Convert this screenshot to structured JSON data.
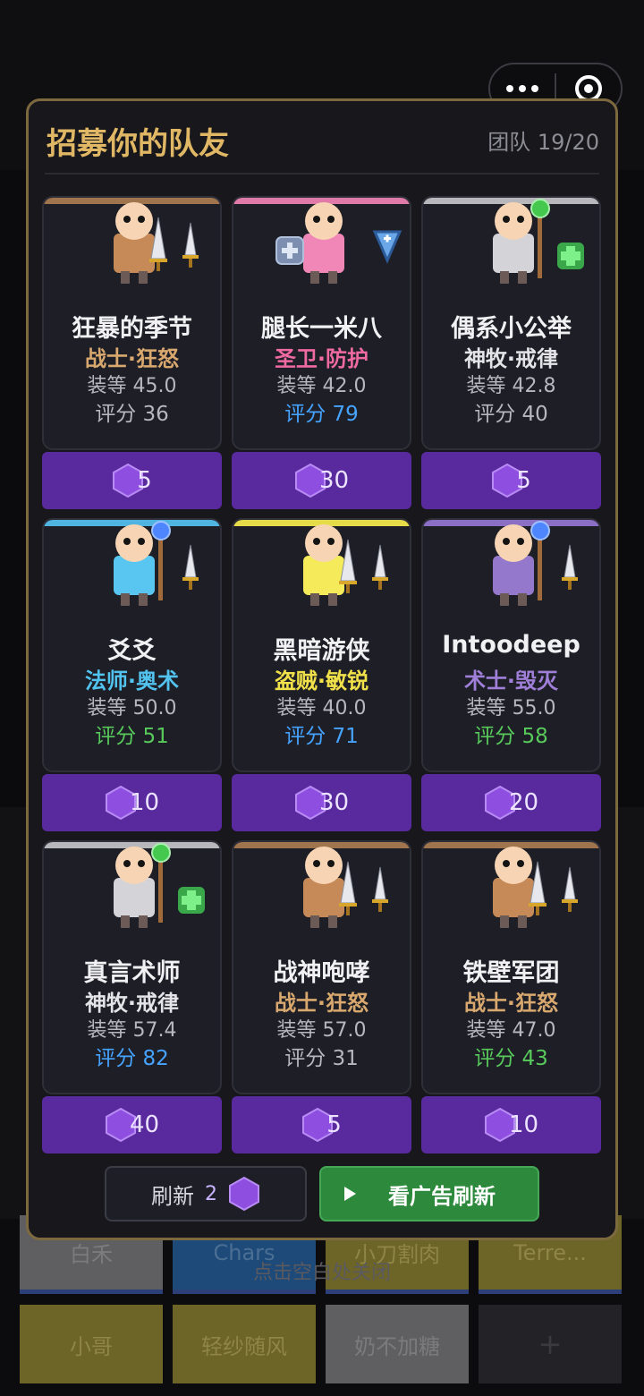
{
  "modal": {
    "title": "招募你的队友",
    "team_count": "团队 19/20"
  },
  "colors": {
    "gold": "#e0b765",
    "warrior": "#d8a86e",
    "paladin": "#ee6aa0",
    "priest": "#e4e4e8",
    "mage": "#52c3ef",
    "rogue": "#f0e04a",
    "warlock": "#a07fd8",
    "score_white": "#b7b7be",
    "score_blue": "#46a3ff",
    "score_green": "#58c95b",
    "price_purple": "#59299e"
  },
  "candidates": [
    {
      "name": "狂暴的季节",
      "class": "战士·狂怒",
      "gear": "装等 45.0",
      "score": "评分 36",
      "price": "5",
      "class_color": "#d8a86e",
      "score_color": "#b7b7be",
      "body": "#c58a58",
      "bar": "#a0754d",
      "icon": "sword-icon"
    },
    {
      "name": "腿长一米八",
      "class": "圣卫·防护",
      "gear": "装等 42.0",
      "score": "评分 79",
      "price": "30",
      "class_color": "#ee6aa0",
      "score_color": "#46a3ff",
      "body": "#f087b6",
      "bar": "#e07aa8",
      "icon": "shield-icon"
    },
    {
      "name": "偶系小公举",
      "class": "神牧·戒律",
      "gear": "装等 42.8",
      "score": "评分 40",
      "price": "5",
      "class_color": "#e4e4e8",
      "score_color": "#b7b7be",
      "body": "#d4d4d8",
      "bar": "#b8b8bc",
      "icon": "heal-cross-icon"
    },
    {
      "name": "爻爻",
      "class": "法师·奥术",
      "gear": "装等 50.0",
      "score": "评分 51",
      "price": "10",
      "class_color": "#52c3ef",
      "score_color": "#58c95b",
      "body": "#58c6f0",
      "bar": "#50b4e0",
      "icon": "sword-icon"
    },
    {
      "name": "黑暗游侠",
      "class": "盗贼·敏锐",
      "gear": "装等 40.0",
      "score": "评分 71",
      "price": "30",
      "class_color": "#f0e04a",
      "score_color": "#46a3ff",
      "body": "#f4ea5a",
      "bar": "#e6dc4a",
      "icon": "sword-icon"
    },
    {
      "name": "Intoodeep",
      "class": "术士·毁灭",
      "gear": "装等 55.0",
      "score": "评分 58",
      "price": "20",
      "class_color": "#a07fd8",
      "score_color": "#58c95b",
      "body": "#9478cc",
      "bar": "#8a6fc4",
      "icon": "sword-icon"
    },
    {
      "name": "真言术师",
      "class": "神牧·戒律",
      "gear": "装等 57.4",
      "score": "评分 82",
      "price": "40",
      "class_color": "#e4e4e8",
      "score_color": "#46a3ff",
      "body": "#d4d4d8",
      "bar": "#b8b8bc",
      "icon": "heal-cross-icon"
    },
    {
      "name": "战神咆哮",
      "class": "战士·狂怒",
      "gear": "装等 57.0",
      "score": "评分 31",
      "price": "5",
      "class_color": "#d8a86e",
      "score_color": "#b7b7be",
      "body": "#c58a58",
      "bar": "#a0754d",
      "icon": "sword-icon"
    },
    {
      "name": "铁壁军团",
      "class": "战士·狂怒",
      "gear": "装等 47.0",
      "score": "评分 43",
      "price": "10",
      "class_color": "#d8a86e",
      "score_color": "#58c95b",
      "body": "#c58a58",
      "bar": "#a0754d",
      "icon": "sword-icon"
    }
  ],
  "footer": {
    "refresh_label": "刷新",
    "refresh_count": "2",
    "ad_refresh_label": "看广告刷新"
  },
  "background": {
    "close_hint": "点击空白处关闭",
    "tiles": [
      "白禾",
      "Chars",
      "小刀割肉",
      "Terre...",
      "小哥",
      "轻纱随风",
      "奶不加糖",
      "+"
    ]
  }
}
